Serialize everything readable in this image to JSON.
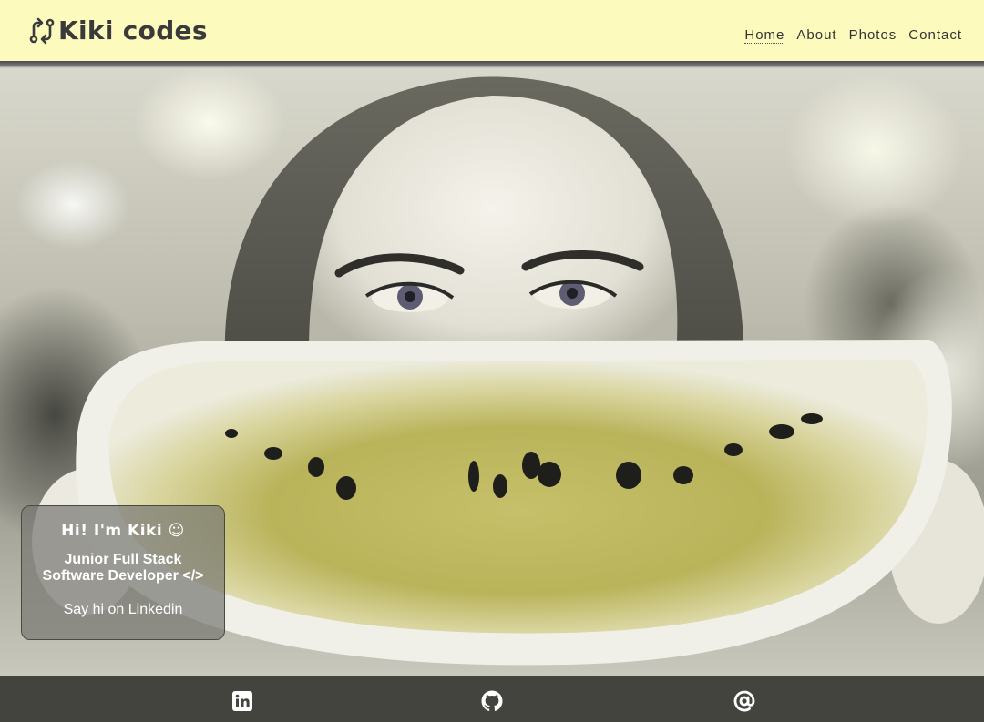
{
  "header": {
    "brand": {
      "icon": "arrows-exchange-icon",
      "label": "Kiki codes"
    },
    "nav": [
      {
        "label": "Home",
        "active": true
      },
      {
        "label": "About",
        "active": false
      },
      {
        "label": "Photos",
        "active": false
      },
      {
        "label": "Contact",
        "active": false
      }
    ]
  },
  "hero": {
    "image": "woman-holding-watermelon-smile-photo",
    "card": {
      "greeting": "Hi! I'm Kiki ☺",
      "role_line1": "Junior Full Stack",
      "role_line2": "Software Developer </>",
      "link": "Say hi on Linkedin"
    }
  },
  "footer": {
    "icons": [
      "linkedin-icon",
      "github-icon",
      "at-sign-icon"
    ]
  },
  "colors": {
    "header_bg": "#fdfabd",
    "footer_bg": "#44443e",
    "text_dark": "#3a3a3a",
    "watermelon": "#c9c46a"
  }
}
